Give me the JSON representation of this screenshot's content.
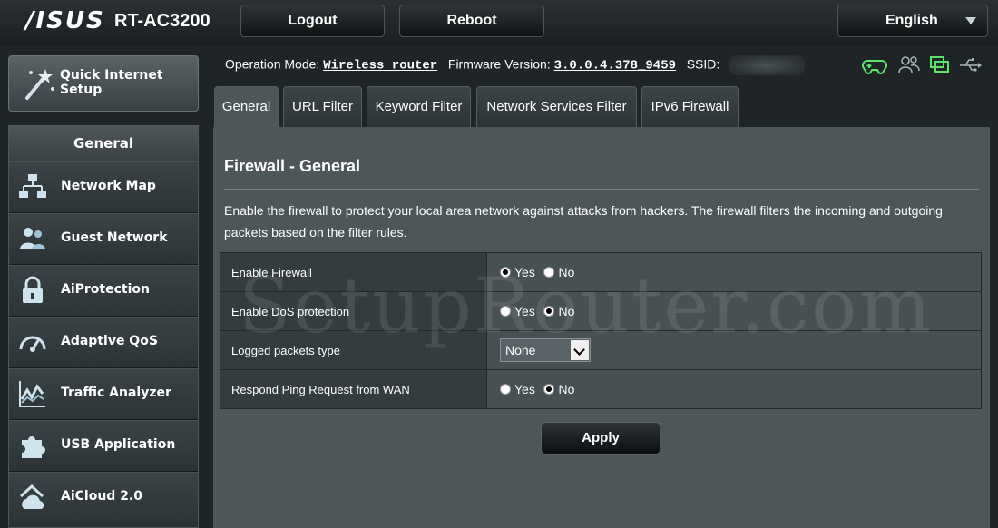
{
  "brand": {
    "logo": "/ISUS",
    "model": "RT-AC3200"
  },
  "header": {
    "logout_label": "Logout",
    "reboot_label": "Reboot",
    "language": "English"
  },
  "sidebar": {
    "quick_setup_label": "Quick Internet Setup",
    "section_title": "General",
    "items": [
      {
        "label": "Network Map",
        "icon": "network-map-icon"
      },
      {
        "label": "Guest Network",
        "icon": "guest-network-icon"
      },
      {
        "label": "AiProtection",
        "icon": "lock-icon"
      },
      {
        "label": "Adaptive QoS",
        "icon": "speedometer-icon"
      },
      {
        "label": "Traffic Analyzer",
        "icon": "traffic-chart-icon"
      },
      {
        "label": "USB Application",
        "icon": "puzzle-icon"
      },
      {
        "label": "AiCloud 2.0",
        "icon": "cloud-home-icon"
      }
    ]
  },
  "status": {
    "op_mode_label": "Operation Mode:",
    "op_mode_value": "Wireless router",
    "firmware_label": "Firmware Version:",
    "firmware_value": "3.0.0.4.378_9459",
    "ssid_label": "SSID:",
    "icons": [
      "gamepad-icon",
      "clients-icon",
      "monitor-icon",
      "usb-icon"
    ]
  },
  "tabs": [
    "General",
    "URL Filter",
    "Keyword Filter",
    "Network Services Filter",
    "IPv6 Firewall"
  ],
  "main": {
    "title": "Firewall - General",
    "description": "Enable the firewall to protect your local area network against attacks from hackers. The firewall filters the incoming and outgoing packets based on the filter rules.",
    "rows": [
      {
        "label": "Enable Firewall",
        "yes": "Yes",
        "no": "No",
        "selected": "Yes"
      },
      {
        "label": "Enable DoS protection",
        "yes": "Yes",
        "no": "No",
        "selected": "No"
      },
      {
        "label": "Logged packets type",
        "select_value": "None"
      },
      {
        "label": "Respond Ping Request from WAN",
        "yes": "Yes",
        "no": "No",
        "selected": "No"
      }
    ],
    "apply_label": "Apply"
  },
  "watermark": "SetupRouter.com",
  "colors": {
    "background": "#1f2427",
    "panel": "#4d5659",
    "status_icon_green": "#5be36a"
  }
}
